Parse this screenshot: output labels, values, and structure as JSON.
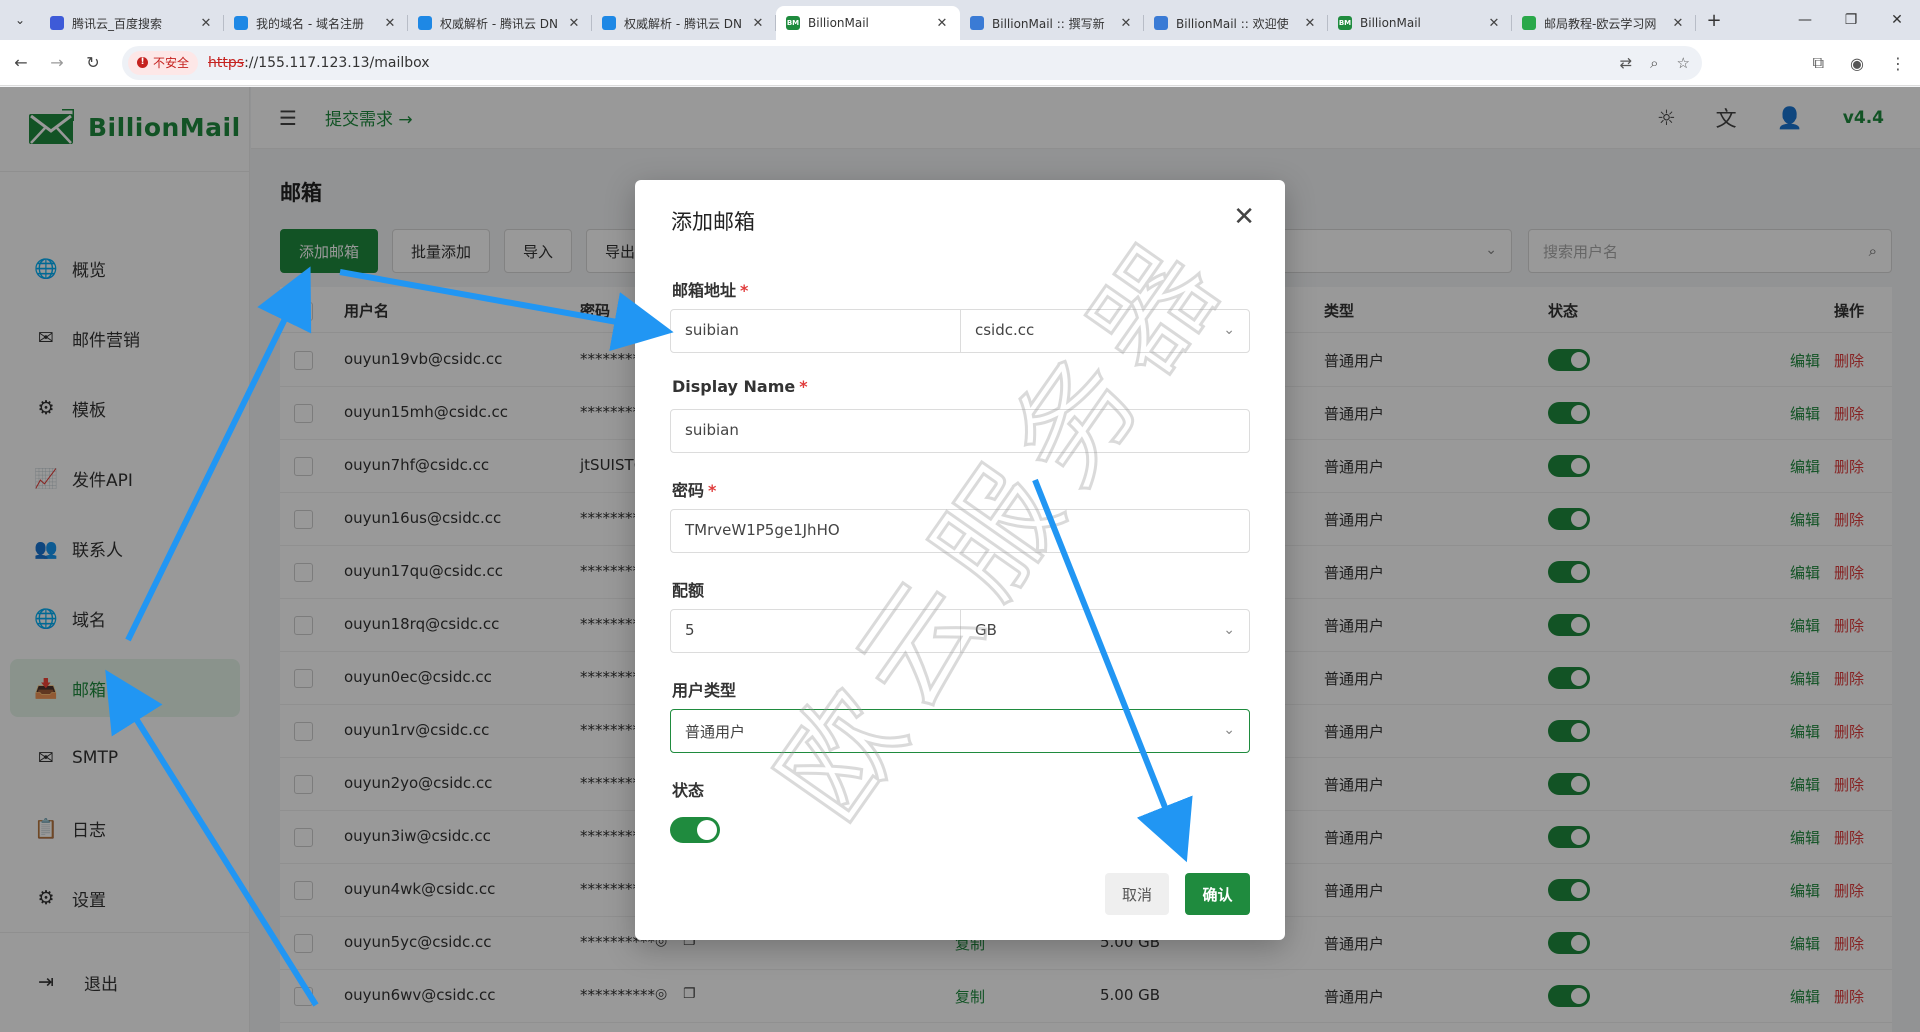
{
  "browser": {
    "tabs": [
      {
        "title": "腾讯云_百度搜索",
        "active": false,
        "icon": "paw-icon",
        "color": "#3e5bd8"
      },
      {
        "title": "我的域名 - 域名注册",
        "active": false,
        "icon": "cloud-icon",
        "color": "#1e88e5"
      },
      {
        "title": "权威解析 - 腾讯云 DN",
        "active": false,
        "icon": "cloud-icon",
        "color": "#1e88e5"
      },
      {
        "title": "权威解析 - 腾讯云 DN",
        "active": false,
        "icon": "cloud-icon",
        "color": "#1e88e5"
      },
      {
        "title": "BillionMail",
        "active": true,
        "icon": "bm-icon",
        "color": "#1f8b3e"
      },
      {
        "title": "BillionMail :: 撰写新",
        "active": false,
        "icon": "cube-icon",
        "color": "#3a7bd5"
      },
      {
        "title": "BillionMail :: 欢迎使",
        "active": false,
        "icon": "cube-icon",
        "color": "#3a7bd5"
      },
      {
        "title": "BillionMail",
        "active": false,
        "icon": "bm-icon",
        "color": "#1f8b3e"
      },
      {
        "title": "邮局教程-欧云学习网",
        "active": false,
        "icon": "leaf-icon",
        "color": "#2aa84a"
      }
    ],
    "bm_badge": "BM",
    "insecure_label": "不安全",
    "url_scheme": "https",
    "url_rest": "://155.117.123.13/mailbox"
  },
  "app": {
    "logo_text": "BillionMail",
    "submit_link": "提交需求 →",
    "version": "v4.4",
    "menu": [
      {
        "label": "概览",
        "icon": "globe-icon",
        "glyph": "🌐",
        "active": false
      },
      {
        "label": "邮件营销",
        "icon": "mail-marketing-icon",
        "glyph": "✉",
        "active": false
      },
      {
        "label": "模板",
        "icon": "gear-icon",
        "glyph": "⚙",
        "active": false
      },
      {
        "label": "发件API",
        "icon": "chart-line-icon",
        "glyph": "📈",
        "active": false
      },
      {
        "label": "联系人",
        "icon": "contacts-icon",
        "glyph": "👥",
        "active": false
      },
      {
        "label": "域名",
        "icon": "globe-icon",
        "glyph": "🌐",
        "active": false
      },
      {
        "label": "邮箱",
        "icon": "mailbox-icon",
        "glyph": "📥",
        "active": true
      },
      {
        "label": "SMTP",
        "icon": "smtp-icon",
        "glyph": "✉",
        "active": false
      },
      {
        "label": "日志",
        "icon": "log-icon",
        "glyph": "📋",
        "active": false
      },
      {
        "label": "设置",
        "icon": "settings-icon",
        "glyph": "⚙",
        "active": false
      }
    ],
    "logout": "退出",
    "page_title": "邮箱",
    "toolbar": {
      "add": "添加邮箱",
      "batch_add": "批量添加",
      "import": "导入",
      "export": "导出全部"
    },
    "search_placeholder": "搜索用户名",
    "columns": {
      "username": "用户名",
      "password": "密码",
      "type": "类型",
      "status": "状态",
      "actions": "操作"
    },
    "rows": [
      {
        "username": "ouyun19vb@csidc.cc",
        "password": "**********",
        "type": "普通用户"
      },
      {
        "username": "ouyun15mh@csidc.cc",
        "password": "**********",
        "type": "普通用户"
      },
      {
        "username": "ouyun7hf@csidc.cc",
        "password": "jtSUIST6",
        "type": "普通用户"
      },
      {
        "username": "ouyun16us@csidc.cc",
        "password": "**********",
        "type": "普通用户"
      },
      {
        "username": "ouyun17qu@csidc.cc",
        "password": "**********",
        "type": "普通用户"
      },
      {
        "username": "ouyun18rq@csidc.cc",
        "password": "**********",
        "type": "普通用户"
      },
      {
        "username": "ouyun0ec@csidc.cc",
        "password": "**********",
        "type": "普通用户"
      },
      {
        "username": "ouyun1rv@csidc.cc",
        "password": "**********",
        "type": "普通用户"
      },
      {
        "username": "ouyun2yo@csidc.cc",
        "password": "**********",
        "type": "普通用户"
      },
      {
        "username": "ouyun3iw@csidc.cc",
        "password": "**********",
        "type": "普通用户"
      },
      {
        "username": "ouyun4wk@csidc.cc",
        "password": "**********",
        "type": "普通用户"
      },
      {
        "username": "ouyun5yc@csidc.cc",
        "password": "**********",
        "type": "普通用户",
        "copy": "复制",
        "quota": "5.00 GB"
      },
      {
        "username": "ouyun6wv@csidc.cc",
        "password": "**********",
        "type": "普通用户",
        "copy": "复制",
        "quota": "5.00 GB"
      }
    ],
    "edit_label": "编辑",
    "delete_label": "删除"
  },
  "modal": {
    "title": "添加邮箱",
    "email_label": "邮箱地址",
    "email_local": "suibian",
    "email_domain": "csidc.cc",
    "display_name_label": "Display Name",
    "display_name": "suibian",
    "password_label": "密码",
    "password": "TMrveW1P5ge1JhHO",
    "quota_label": "配额",
    "quota_value": "5",
    "quota_unit": "GB",
    "user_type_label": "用户类型",
    "user_type": "普通用户",
    "status_label": "状态",
    "status_on": true,
    "required_mark": "*",
    "cancel": "取消",
    "confirm": "确认"
  },
  "watermark": "欧云服务器",
  "colors": {
    "brand": "#1f8b3e",
    "danger": "#e03c3c",
    "arrow": "#2196f3"
  }
}
